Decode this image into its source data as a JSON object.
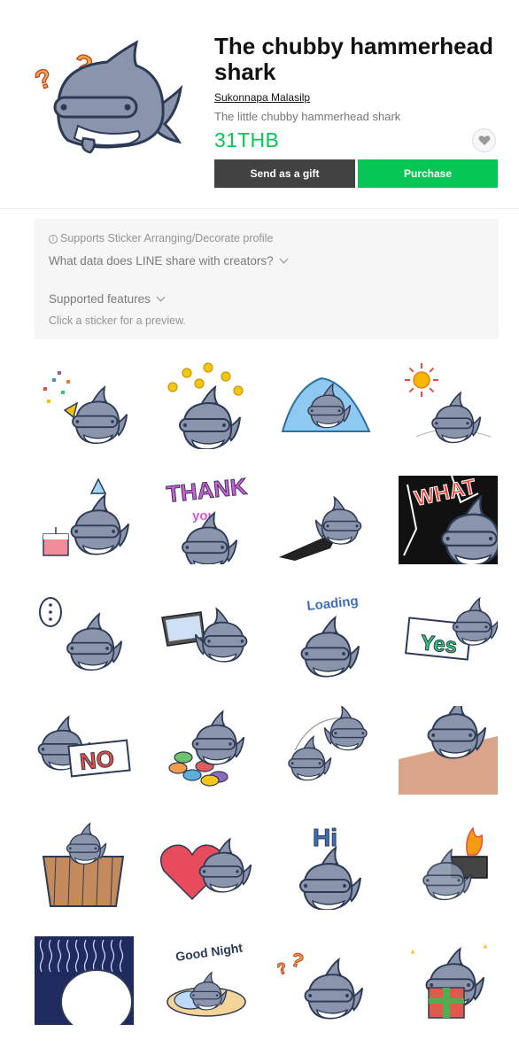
{
  "header": {
    "title": "The chubby hammerhead shark",
    "author": "Sukonnapa Malasilp",
    "description": "The little chubby hammerhead shark",
    "price": "31THB",
    "gift_label": "Send as a gift",
    "purchase_label": "Purchase"
  },
  "info": {
    "supports": "Supports Sticker Arranging/Decorate profile",
    "data_share": "What data does LINE share with creators?",
    "features": "Supported features",
    "hint": "Click a sticker for a preview."
  },
  "colors": {
    "accent_green": "#06c755",
    "gift_button": "#424242",
    "shark_body": "#8a95ab",
    "outline": "#2d3a55"
  },
  "stickers": [
    {
      "name": "party-popper",
      "text": ""
    },
    {
      "name": "coins",
      "text": ""
    },
    {
      "name": "ice-block",
      "text": ""
    },
    {
      "name": "hot-sun",
      "text": ""
    },
    {
      "name": "birthday-cake",
      "text": ""
    },
    {
      "name": "thank-you",
      "text": "THANK\nyou"
    },
    {
      "name": "zooming",
      "text": ""
    },
    {
      "name": "what-shock",
      "text": "WHAT"
    },
    {
      "name": "speech-dots",
      "text": ""
    },
    {
      "name": "laptop",
      "text": ""
    },
    {
      "name": "loading",
      "text": "Loading"
    },
    {
      "name": "yes-sign",
      "text": "Yes"
    },
    {
      "name": "no-sign",
      "text": "NO"
    },
    {
      "name": "fish-pile",
      "text": ""
    },
    {
      "name": "flipping",
      "text": ""
    },
    {
      "name": "peek-wall",
      "text": ""
    },
    {
      "name": "bath-tub",
      "text": ""
    },
    {
      "name": "heart",
      "text": ""
    },
    {
      "name": "hi-wave",
      "text": "Hi"
    },
    {
      "name": "toaster-fire",
      "text": ""
    },
    {
      "name": "gloomy",
      "text": ""
    },
    {
      "name": "good-night",
      "text": "Good Night"
    },
    {
      "name": "question",
      "text": ""
    },
    {
      "name": "gift-box",
      "text": ""
    }
  ]
}
